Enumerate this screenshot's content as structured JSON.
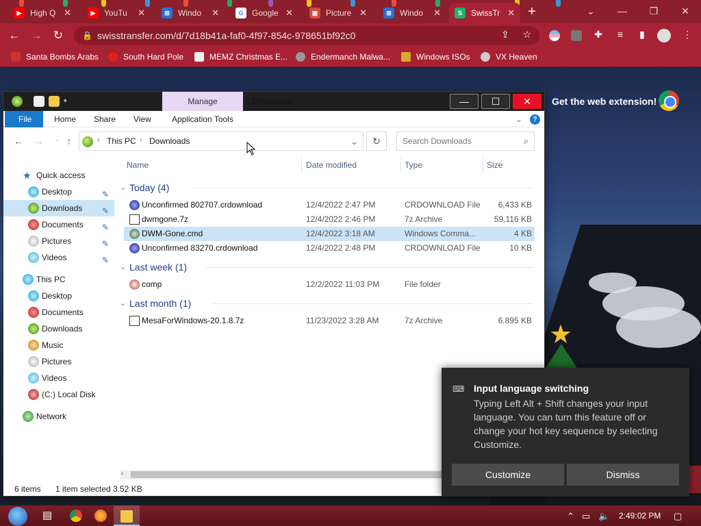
{
  "browser": {
    "tabs": [
      {
        "title": "High Q",
        "icon": "youtube-icon",
        "color": "#ff0000"
      },
      {
        "title": "YouTu",
        "icon": "youtube-icon",
        "color": "#ff0000"
      },
      {
        "title": "Windo",
        "icon": "windows-icon",
        "color": "#2a6fd6"
      },
      {
        "title": "Google",
        "icon": "google-icon",
        "color": "#ffffff"
      },
      {
        "title": "Picture",
        "icon": "picture-icon",
        "color": "#d94a3a"
      },
      {
        "title": "Windo",
        "icon": "windows-icon",
        "color": "#2a6fd6"
      },
      {
        "title": "SwissTr",
        "icon": "swisstransfer-icon",
        "color": "#1cb36b"
      }
    ],
    "url": "swisstransfer.com/d/7d18b41a-faf0-4f97-854c-978651bf92c0",
    "bookmarks": [
      "Santa Bombs Arabs",
      "South Hard Pole",
      "MEMZ Christmas E...",
      "Endermanch Malwa...",
      "Windows ISOs",
      "VX Heaven"
    ],
    "theme_color": "#a72233"
  },
  "page": {
    "extension_banner": "Get the web extension!"
  },
  "explorer": {
    "manage_tab": "Manage",
    "title": "Downloads",
    "ribbon_tabs": [
      "File",
      "Home",
      "Share",
      "View",
      "Application Tools"
    ],
    "breadcrumb": [
      "This PC",
      "Downloads"
    ],
    "search_placeholder": "Search Downloads",
    "nav": {
      "quick_access": "Quick access",
      "quick_items": [
        "Desktop",
        "Downloads",
        "Documents",
        "Pictures",
        "Videos"
      ],
      "this_pc": "This PC",
      "pc_items": [
        "Desktop",
        "Documents",
        "Downloads",
        "Music",
        "Pictures",
        "Videos",
        "(C:) Local Disk"
      ],
      "network": "Network"
    },
    "columns": [
      "Name",
      "Date modified",
      "Type",
      "Size"
    ],
    "groups": [
      {
        "label": "Today (4)",
        "files": [
          {
            "name": "Unconfirmed 802707.crdownload",
            "date": "12/4/2022 2:47 PM",
            "type": "CRDOWNLOAD File",
            "size": "6,433 KB"
          },
          {
            "name": "dwmgone.7z",
            "date": "12/4/2022 2:46 PM",
            "type": "7z Archive",
            "size": "59,116 KB"
          },
          {
            "name": "DWM-Gone.cmd",
            "date": "12/4/2022 3:18 AM",
            "type": "Windows Comma...",
            "size": "4 KB"
          },
          {
            "name": "Unconfirmed 83270.crdownload",
            "date": "12/4/2022 2:48 PM",
            "type": "CRDOWNLOAD File",
            "size": "10 KB"
          }
        ]
      },
      {
        "label": "Last week (1)",
        "files": [
          {
            "name": "comp",
            "date": "12/2/2022 11:03 PM",
            "type": "File folder",
            "size": ""
          }
        ]
      },
      {
        "label": "Last month (1)",
        "files": [
          {
            "name": "MesaForWindows-20.1.8.7z",
            "date": "11/23/2022 3:28 AM",
            "type": "7z Archive",
            "size": "6,895 KB"
          }
        ]
      }
    ],
    "status": {
      "items": "6 items",
      "selected": "1 item selected",
      "size": "3.52 KB"
    }
  },
  "toast": {
    "title": "Input language switching",
    "body": "Typing Left Alt + Shift changes your input language. You can turn this feature off or change your hot key sequence by selecting Customize.",
    "customize": "Customize",
    "dismiss": "Dismiss"
  },
  "taskbar": {
    "clock": "2:49:02 PM"
  }
}
